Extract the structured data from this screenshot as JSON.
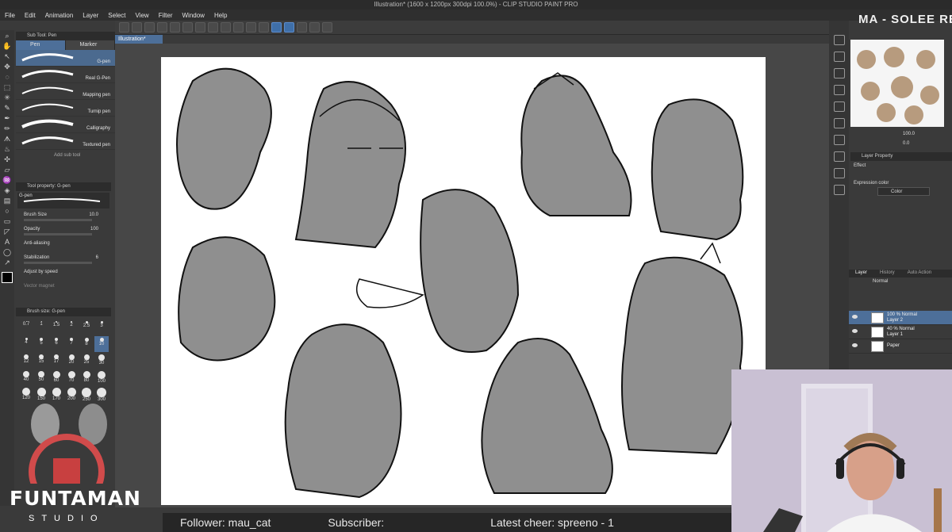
{
  "window": {
    "title": "Illustration* (1600 x 1200px 300dpi 100.0%)  - CLIP STUDIO PAINT PRO"
  },
  "menu": [
    "File",
    "Edit",
    "Animation",
    "Layer",
    "Select",
    "View",
    "Filter",
    "Window",
    "Help"
  ],
  "document_tab": "Illustration*",
  "subtool": {
    "header": "Sub Tool: Pen",
    "tabs": [
      "Pen",
      "Marker"
    ],
    "brushes": [
      "G-pen",
      "Real G-Pen",
      "Mapping pen",
      "Turnip pen",
      "Calligraphy",
      "Textured pen"
    ],
    "add_label": "Add sub tool"
  },
  "tool_property": {
    "header": "Tool property: G-pen",
    "preview_label": "G-pen",
    "brush_size_label": "Brush Size",
    "brush_size_value": "10.0",
    "opacity_label": "Opacity",
    "opacity_value": "100",
    "anti_aliasing_label": "Anti-aliasing",
    "stabilization_label": "Stabilization",
    "stabilization_value": "6",
    "adjust_speed_label": "Adjust by speed",
    "vector_magnet_label": "Vector magnet"
  },
  "brush_size_palette": {
    "header": "Brush size: G-pen",
    "sizes": [
      "0.7",
      "1",
      "1.5",
      "2",
      "2.5",
      "3",
      "4",
      "5",
      "6",
      "7",
      "8",
      "10",
      "12",
      "15",
      "17",
      "20",
      "25",
      "30",
      "40",
      "50",
      "60",
      "70",
      "80",
      "100",
      "120",
      "150",
      "170",
      "200",
      "250",
      "300"
    ],
    "selected": "10"
  },
  "stream": {
    "title": "MA - SOLEE RE",
    "follower": "Follower: mau_cat",
    "subscriber": "Subscriber:",
    "cheer": "Latest cheer: spreeno - 1"
  },
  "navigator": {
    "zoom": "100.0",
    "angle": "0.0"
  },
  "layer_property": {
    "header": "Layer Property",
    "effect_label": "Effect",
    "expression_color_label": "Expression color",
    "expression_color_value": "Color"
  },
  "layers_panel": {
    "tabs": [
      "Layer",
      "History",
      "Auto Action"
    ],
    "blend_mode": "Normal",
    "layers": [
      {
        "line1": "100 % Normal",
        "line2": "Layer 2",
        "selected": true
      },
      {
        "line1": "40 % Normal",
        "line2": "Layer 1",
        "selected": false
      },
      {
        "line1": "",
        "line2": "Paper",
        "selected": false
      }
    ]
  },
  "logo": {
    "text": "FUNTAMAN",
    "sub": "STUDIO"
  },
  "colors": {
    "accent": "#4d6f99",
    "sketch_fill": "#8f8f8f",
    "panel": "#3a3a3a"
  }
}
